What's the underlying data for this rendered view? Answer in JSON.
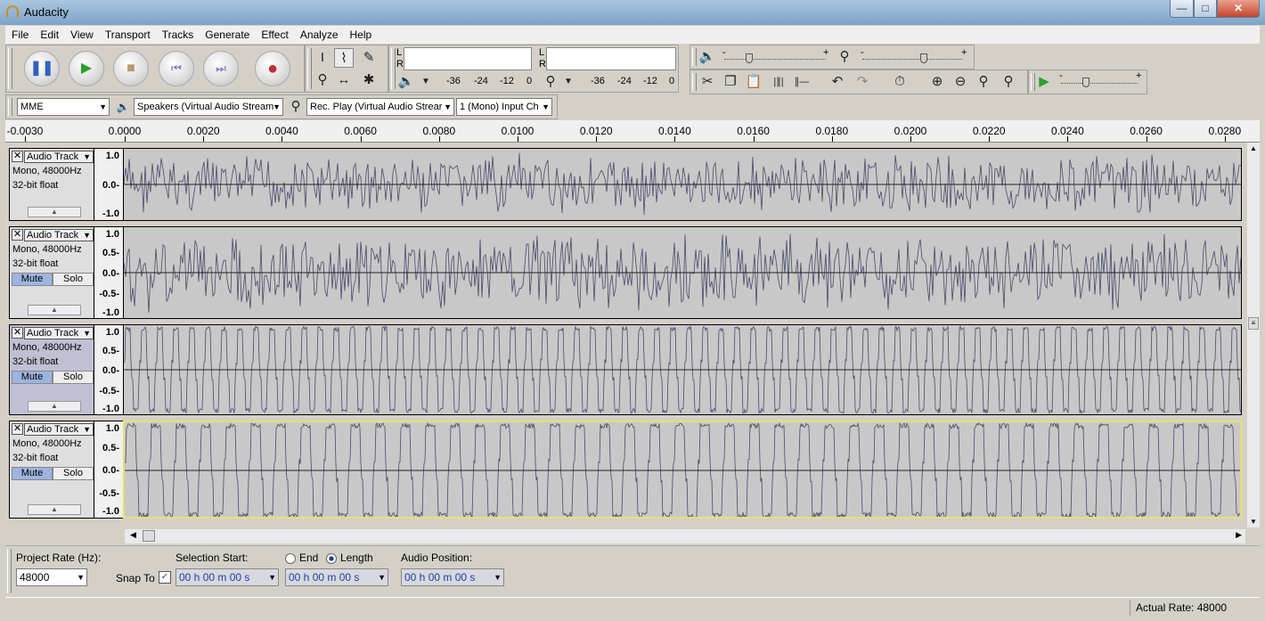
{
  "window": {
    "title": "Audacity"
  },
  "menu": [
    "File",
    "Edit",
    "View",
    "Transport",
    "Tracks",
    "Generate",
    "Effect",
    "Analyze",
    "Help"
  ],
  "meters": {
    "left": "L",
    "right": "R",
    "scale": [
      "-36",
      "-24",
      "-12",
      "0"
    ]
  },
  "sliders": {
    "minus": "-",
    "plus": "+"
  },
  "devices": {
    "host": "MME",
    "output": "Speakers (Virtual Audio Stream",
    "input": "Rec. Play (Virtual Audio Strear",
    "channels": "1 (Mono) Input Ch"
  },
  "ruler": [
    "-0.0030",
    "0.0000",
    "0.0020",
    "0.0040",
    "0.0060",
    "0.0080",
    "0.0100",
    "0.0120",
    "0.0140",
    "0.0160",
    "0.0180",
    "0.0200",
    "0.0220",
    "0.0240",
    "0.0260",
    "0.0280"
  ],
  "tracks": [
    {
      "name": "Audio Track",
      "format": "Mono, 48000Hz",
      "depth": "32-bit float",
      "scale": [
        "1.0",
        "0.0-",
        "-1.0"
      ]
    },
    {
      "name": "Audio Track",
      "format": "Mono, 48000Hz",
      "depth": "32-bit float",
      "mute": "Mute",
      "solo": "Solo",
      "scale": [
        "1.0",
        "0.5-",
        "0.0-",
        "-0.5-",
        "-1.0"
      ]
    },
    {
      "name": "Audio Track",
      "format": "Mono, 48000Hz",
      "depth": "32-bit float",
      "mute": "Mute",
      "solo": "Solo",
      "scale": [
        "1.0",
        "0.5-",
        "0.0-",
        "-0.5-",
        "-1.0"
      ]
    },
    {
      "name": "Audio Track",
      "format": "Mono, 48000Hz",
      "depth": "32-bit float",
      "mute": "Mute",
      "solo": "Solo",
      "scale": [
        "1.0",
        "0.5-",
        "0.0-",
        "-0.5-",
        "-1.0"
      ]
    }
  ],
  "selection": {
    "project_rate_label": "Project Rate (Hz):",
    "project_rate": "48000",
    "snap_label": "Snap To",
    "sel_start_label": "Selection Start:",
    "end_label": "End",
    "length_label": "Length",
    "audio_pos_label": "Audio Position:",
    "time_value": "00 h 00 m 00 s"
  },
  "status": {
    "actual_rate": "Actual Rate: 48000"
  }
}
